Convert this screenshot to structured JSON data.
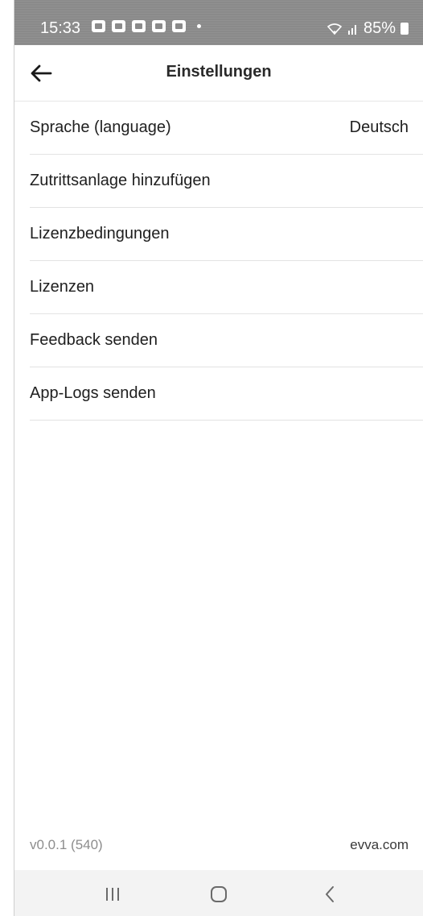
{
  "status_bar": {
    "time": "15:33",
    "battery": "85%",
    "icons": [
      "teams-icon",
      "outlook-icon",
      "calendar-icon",
      "gallery-icon",
      "youtube-icon",
      "wifi-icon",
      "signal-icon",
      "battery-icon"
    ]
  },
  "header": {
    "title": "Einstellungen",
    "back_icon": "arrow-left-icon"
  },
  "settings": {
    "items": [
      {
        "label": "Sprache (language)",
        "value": "Deutsch"
      },
      {
        "label": "Zutrittsanlage hinzufügen"
      },
      {
        "label": "Lizenzbedingungen"
      },
      {
        "label": "Lizenzen"
      },
      {
        "label": "Feedback senden"
      },
      {
        "label": "App-Logs senden"
      }
    ]
  },
  "footer": {
    "version": "v0.0.1 (540)",
    "website": "evva.com"
  },
  "nav_bar": {
    "icons": [
      "recents-icon",
      "home-icon",
      "back-icon"
    ]
  },
  "colors": {
    "status_bar_bg": "#8a8a8a",
    "divider": "#e3e3e3",
    "text": "#202020",
    "muted": "#8d8d8d",
    "nav_bg": "#f3f3f3"
  }
}
